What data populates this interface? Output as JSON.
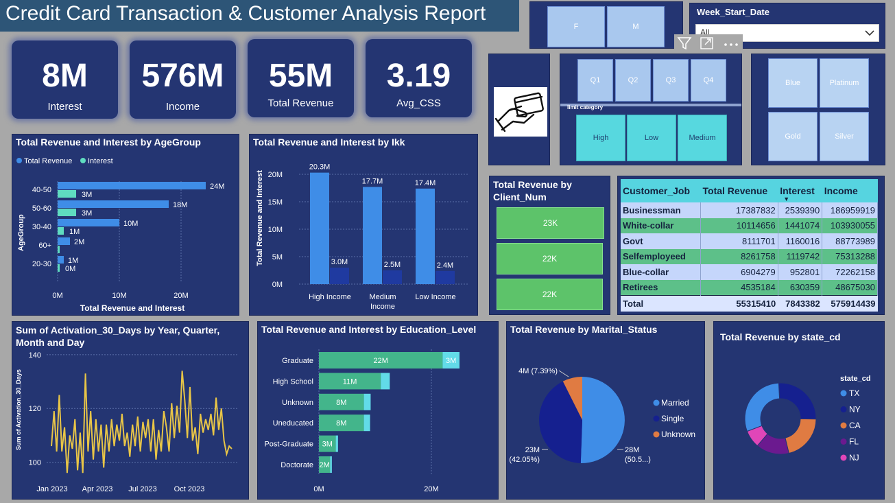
{
  "title": "Credit Card Transaction & Customer Analysis Report",
  "kpis": [
    {
      "value": "8M",
      "label": "Interest"
    },
    {
      "value": "576M",
      "label": "Income"
    },
    {
      "value": "55M",
      "label": "Total Revenue"
    },
    {
      "value": "3.19",
      "label": "Avg_CSS"
    }
  ],
  "gender_slicer": [
    "F",
    "M"
  ],
  "week_slicer": {
    "label": "Week_Start_Date",
    "value": "All"
  },
  "quarter_slicer": [
    "Q1",
    "Q2",
    "Q3",
    "Q4"
  ],
  "limit_slicer": {
    "label": "limit category",
    "items": [
      "High",
      "Low",
      "Medium"
    ]
  },
  "card_slicer": [
    "Blue",
    "Platinum",
    "Gold",
    "Silver"
  ],
  "visual_header_icons": [
    "filter-icon",
    "focus-mode-icon",
    "more-options-icon"
  ],
  "colors": {
    "revenue": "#3f8de7",
    "interest": "#5fdcc0",
    "dark_interest": "#1f3aa0",
    "green": "#5dc36a",
    "panel": "#243572"
  },
  "client_num": {
    "title": "Total Revenue by Client_Num",
    "values": [
      "23K",
      "22K",
      "22K"
    ]
  },
  "job_table": {
    "headers": [
      "Customer_Job",
      "Total Revenue",
      "Interest",
      "Income"
    ],
    "rows": [
      [
        "Businessman",
        "17387832",
        "2539390",
        "186959919"
      ],
      [
        "White-collar",
        "10114656",
        "1441074",
        "103930055"
      ],
      [
        "Govt",
        "8111701",
        "1160016",
        "88773989"
      ],
      [
        "Selfemployeed",
        "8261758",
        "1119742",
        "75313288"
      ],
      [
        "Blue-collar",
        "6904279",
        "952801",
        "72262158"
      ],
      [
        "Retirees",
        "4535184",
        "630359",
        "48675030"
      ]
    ],
    "total": [
      "Total",
      "55315410",
      "7843382",
      "575914439"
    ]
  },
  "chart_data": [
    {
      "type": "bar",
      "title": "Total Revenue and Interest by AgeGroup",
      "orientation": "horizontal",
      "categories": [
        "40-50",
        "50-60",
        "30-40",
        "60+",
        "20-30"
      ],
      "series": [
        {
          "name": "Total Revenue",
          "values": [
            24,
            18,
            10,
            2,
            1
          ],
          "labels": [
            "24M",
            "18M",
            "10M",
            "2M",
            "1M"
          ]
        },
        {
          "name": "Interest",
          "values": [
            3,
            3,
            1,
            0,
            0
          ],
          "labels": [
            "3M",
            "3M",
            "1M",
            "",
            "0M"
          ]
        }
      ],
      "xlabel": "Total Revenue and Interest",
      "ylabel": "AgeGroup",
      "xticks": [
        "0M",
        "10M",
        "20M"
      ],
      "xlim": [
        0,
        27
      ],
      "legend": "top"
    },
    {
      "type": "bar",
      "title": "Total Revenue and Interest by Ikk",
      "categories": [
        "High Income",
        "Medium Income",
        "Low Income"
      ],
      "series": [
        {
          "name": "Total Revenue",
          "values": [
            20.3,
            17.7,
            17.4
          ],
          "labels": [
            "20.3M",
            "17.7M",
            "17.4M"
          ]
        },
        {
          "name": "Interest",
          "values": [
            3.0,
            2.5,
            2.4
          ],
          "labels": [
            "3.0M",
            "2.5M",
            "2.4M"
          ]
        }
      ],
      "ylabel": "Total Revenue and Interest",
      "yticks": [
        "0M",
        "5M",
        "10M",
        "15M",
        "20M"
      ],
      "ylim": [
        0,
        20
      ]
    },
    {
      "type": "line",
      "title": "Sum of Activation_30_Days by Year, Quarter, Month and Day",
      "ylabel": "Sum of Activation_30_Days",
      "xticks": [
        "Jan 2023",
        "Apr 2023",
        "Jul 2023",
        "Oct 2023"
      ],
      "yticks": [
        100,
        120,
        140
      ],
      "ylim": [
        93,
        142
      ],
      "values": [
        106,
        119,
        104,
        125,
        104,
        113,
        96,
        110,
        105,
        116,
        97,
        111,
        96,
        133,
        104,
        119,
        101,
        116,
        104,
        114,
        98,
        114,
        104,
        116,
        106,
        114,
        108,
        118,
        106,
        111,
        102,
        114,
        106,
        117,
        104,
        115,
        109,
        116,
        104,
        116,
        101,
        112,
        104,
        119,
        113,
        104,
        122,
        109,
        121,
        111,
        134,
        123,
        109,
        128,
        108,
        113,
        103,
        118,
        111,
        116,
        112,
        118,
        110,
        124,
        112,
        120,
        108,
        103,
        106,
        105
      ]
    },
    {
      "type": "bar",
      "title": "Total Revenue and Interest by Education_Level",
      "orientation": "horizontal",
      "stacked": true,
      "categories": [
        "Graduate",
        "High School",
        "Unknown",
        "Uneducated",
        "Post-Graduate",
        "Doctorate"
      ],
      "series": [
        {
          "name": "Total Revenue",
          "values": [
            22,
            11,
            8,
            8,
            3,
            2
          ],
          "labels": [
            "22M",
            "11M",
            "8M",
            "8M",
            "3M",
            "2M"
          ]
        },
        {
          "name": "Interest",
          "values": [
            3,
            1.6,
            1.2,
            1.1,
            0.4,
            0.3
          ],
          "labels": [
            "3M",
            "",
            "",
            "",
            "",
            ""
          ]
        }
      ],
      "xticks": [
        "0M",
        "20M"
      ],
      "xlim": [
        0,
        25
      ]
    },
    {
      "type": "pie",
      "title": "Total Revenue by Marital_Status",
      "categories": [
        "Married",
        "Single",
        "Unknown"
      ],
      "values": [
        50.56,
        42.05,
        7.39
      ],
      "labels": [
        "28M\n(50.5...)",
        "23M\n(42.05%)",
        "4M (7.39%)"
      ],
      "colors": [
        "#3f8de7",
        "#15208f",
        "#e07b42"
      ],
      "legend": "right"
    },
    {
      "type": "pie",
      "donut": true,
      "title": "Total Revenue by state_cd",
      "legend_title": "state_cd",
      "categories": [
        "TX",
        "NY",
        "CA",
        "FL",
        "NJ"
      ],
      "values": [
        30,
        26,
        21,
        15,
        8
      ],
      "colors": [
        "#3f8de7",
        "#15208f",
        "#e07b42",
        "#6b1a8f",
        "#e046b8"
      ],
      "legend": "right"
    }
  ]
}
